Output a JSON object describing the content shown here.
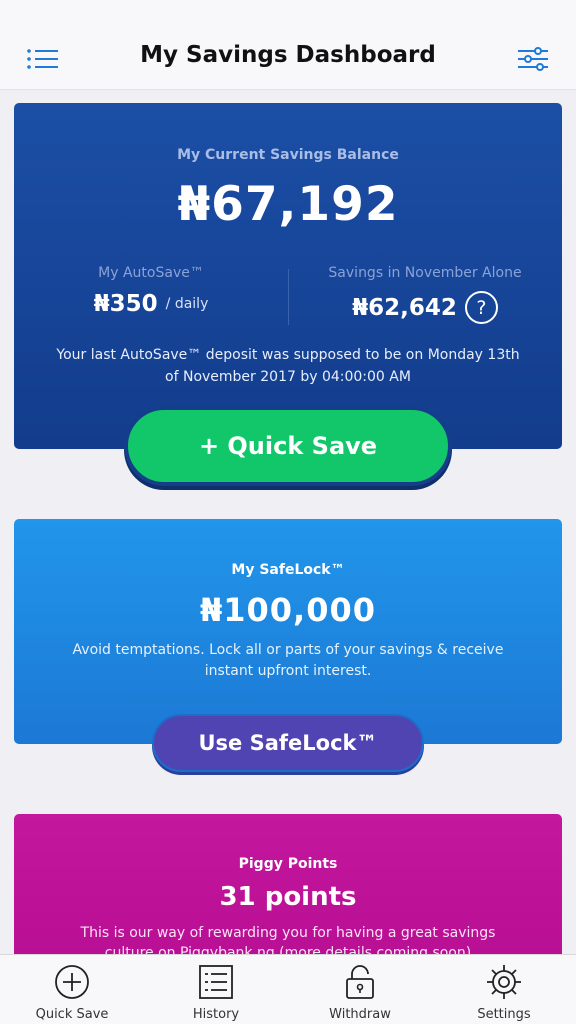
{
  "header": {
    "title": "My Savings Dashboard",
    "menu_icon": "menu-icon",
    "filter_icon": "sliders-icon"
  },
  "balance": {
    "label": "My Current Savings Balance",
    "amount": "₦67,192",
    "autosave": {
      "label": "My AutoSave™",
      "amount": "₦350",
      "unit": "/ daily"
    },
    "month": {
      "label": "Savings in November Alone",
      "amount": "₦62,642",
      "help": "?"
    },
    "note": "Your last AutoSave™ deposit was supposed to be on Monday 13th of November 2017 by 04:00:00 AM",
    "quick_save_label": "+ Quick Save"
  },
  "safelock": {
    "label": "My SafeLock™",
    "amount": "₦100,000",
    "description": "Avoid temptations. Lock all or parts of your savings & receive instant upfront interest.",
    "button_label": "Use SafeLock™"
  },
  "piggy": {
    "label": "Piggy Points",
    "amount": "31 points",
    "description": "This is our way of rewarding you for having a great savings culture on Piggybank.ng (more details coming soon)"
  },
  "tabbar": {
    "items": [
      {
        "label": "Quick Save",
        "icon": "plus-circle-icon"
      },
      {
        "label": "History",
        "icon": "list-icon"
      },
      {
        "label": "Withdraw",
        "icon": "unlock-icon"
      },
      {
        "label": "Settings",
        "icon": "gear-icon"
      }
    ]
  },
  "colors": {
    "balance_card": "#1b4fa6",
    "quick_save": "#12c76a",
    "safelock_card": "#2196ea",
    "safelock_button": "#5044b3",
    "piggy_card": "#c3179e",
    "accent_icon": "#1f7ad8"
  }
}
